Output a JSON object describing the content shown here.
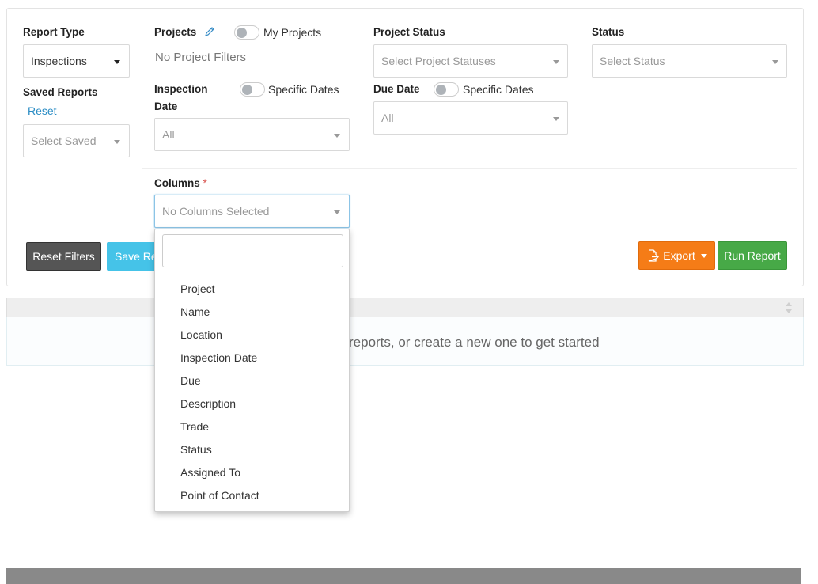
{
  "filters": {
    "report_type": {
      "label": "Report Type",
      "value": "Inspections"
    },
    "saved_reports": {
      "label": "Saved Reports",
      "reset_link": "Reset",
      "placeholder": "Select Saved"
    },
    "projects": {
      "label": "Projects",
      "toggle_label": "My Projects",
      "value_text": "No Project Filters"
    },
    "inspection_date": {
      "label_line1": "Inspection",
      "label_line2": "Date",
      "toggle_label": "Specific Dates",
      "value": "All"
    },
    "project_status": {
      "label": "Project Status",
      "placeholder": "Select Project Statuses"
    },
    "due_date": {
      "label": "Due Date",
      "toggle_label": "Specific Dates",
      "value": "All"
    },
    "status": {
      "label": "Status",
      "placeholder": "Select Status"
    },
    "columns": {
      "label": "Columns",
      "required_mark": "*",
      "placeholder": "No Columns Selected"
    }
  },
  "buttons": {
    "reset_filters": "Reset Filters",
    "save_report": "Save Rep",
    "export": "Export",
    "run_report": "Run Report"
  },
  "colors": {
    "reset_bg": "#555555",
    "save_bg": "#45c3e8",
    "export_bg": "#f57c17",
    "run_bg": "#47a947",
    "link": "#2a8cc4",
    "required": "#d9534f"
  },
  "table": {
    "empty_message": "reports, or create a new one to get started"
  },
  "columns_dropdown": {
    "search_value": "",
    "options": [
      "Project",
      "Name",
      "Location",
      "Inspection Date",
      "Due",
      "Description",
      "Trade",
      "Status",
      "Assigned To",
      "Point of Contact"
    ]
  }
}
